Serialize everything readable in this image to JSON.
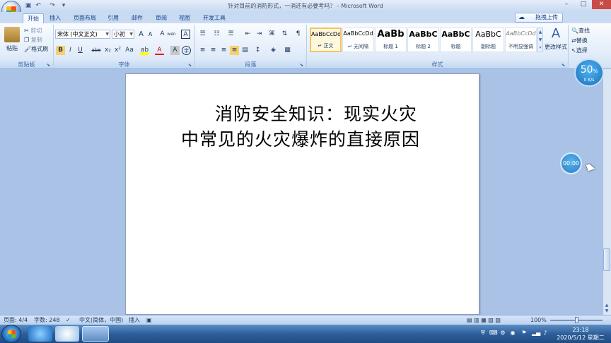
{
  "window": {
    "title": "针对目前的消防形式，一消还有必要考吗？ - Microsoft Word",
    "controls": {
      "minimize": "–",
      "maximize": "□",
      "close": "✕"
    }
  },
  "quick_access": {
    "save": "💾",
    "undo": "↶",
    "redo": "↷",
    "more": "▾"
  },
  "tabs": [
    "开始",
    "插入",
    "页面布局",
    "引用",
    "邮件",
    "审阅",
    "视图",
    "开发工具"
  ],
  "upload_button": "拖拽上传",
  "ribbon": {
    "clipboard": {
      "label": "剪贴板",
      "paste": "粘贴",
      "cut": "剪切",
      "copy": "复制",
      "format_painter": "格式刷"
    },
    "font": {
      "label": "字体",
      "font_name": "宋体 (中文正文)",
      "font_size": "小初",
      "bold": "B",
      "italic": "I",
      "underline": "U",
      "strikethrough": "abe",
      "subscript": "x₂",
      "superscript": "x²",
      "change_case": "Aa",
      "grow": "A",
      "shrink": "A",
      "clear": "A",
      "phonetic": "wén",
      "char_border": "A",
      "highlight": "ab",
      "font_color": "A",
      "char_shading": "A",
      "enclose": "字"
    },
    "paragraph": {
      "label": "段落"
    },
    "styles": {
      "label": "样式",
      "items": [
        {
          "preview": "AaBbCcDd",
          "name": "↵ 正文"
        },
        {
          "preview": "AaBbCcDd",
          "name": "↵ 无间隔"
        },
        {
          "preview": "AaBb",
          "name": "标题 1"
        },
        {
          "preview": "AaBbC",
          "name": "标题 2"
        },
        {
          "preview": "AaBbC",
          "name": "标题"
        },
        {
          "preview": "AaBbC",
          "name": "副标题"
        },
        {
          "preview": "AaBbCcDd",
          "name": "不明显强调"
        }
      ],
      "change_styles": "更改样式"
    },
    "editing": {
      "find": "查找",
      "replace": "替换",
      "select": "选择"
    }
  },
  "document": {
    "title_text": "消防安全知识：现实火灾中常见的火灾爆炸的直接原因"
  },
  "speed_widget": {
    "percent": "50",
    "unit": "%",
    "rate": "0 K/s"
  },
  "timer_widget": {
    "time": "00:00"
  },
  "statusbar": {
    "page": "页面: 4/4",
    "words": "字数: 248",
    "language": "中文(简体，中国)",
    "mode": "插入",
    "zoom": "100%"
  },
  "taskbar": {
    "time": "23:18",
    "date": "2020/5/12 星期二"
  }
}
